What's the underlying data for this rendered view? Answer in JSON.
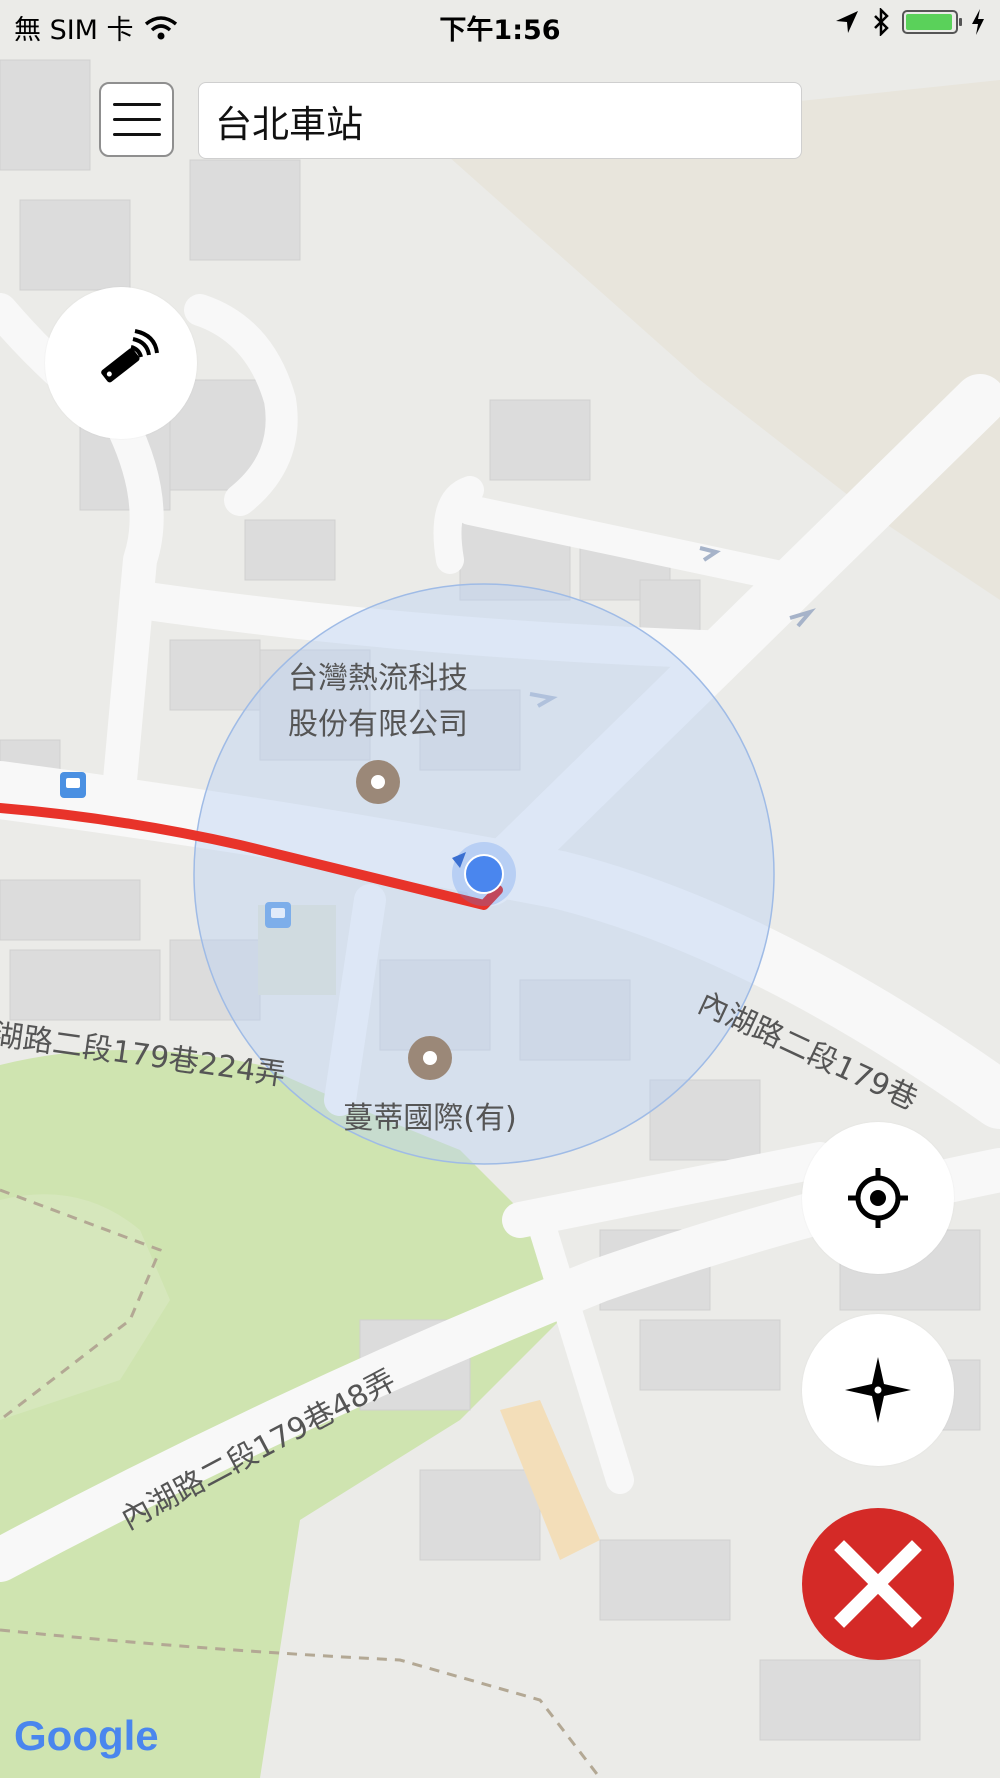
{
  "status_bar": {
    "carrier": "無 SIM 卡",
    "time": "下午1:56",
    "icons": [
      "wifi-icon",
      "location-arrow-icon",
      "bluetooth-icon",
      "battery-icon",
      "charging-icon"
    ]
  },
  "search": {
    "value": "台北車站"
  },
  "map": {
    "poi_1_line1": "台灣熱流科技",
    "poi_1_line2": "股份有限公司",
    "poi_2": "蔓蒂國際(有)",
    "road_1": "內湖路二段179巷",
    "road_2": "湖路二段179巷224弄",
    "road_3": "內湖路二段179巷48弄",
    "attribution": "Google"
  },
  "controls": {
    "remote_button_icon": "remote-signal-icon",
    "locate_button_icon": "crosshair-icon",
    "compass_button_icon": "compass-icon",
    "close_button_icon": "close-icon"
  },
  "colors": {
    "route": "#e8332a",
    "location_dot": "#4a86ee",
    "accuracy_circle": "#bcd3f3",
    "close_button": "#d42a27",
    "park": "#cfe4b0"
  }
}
